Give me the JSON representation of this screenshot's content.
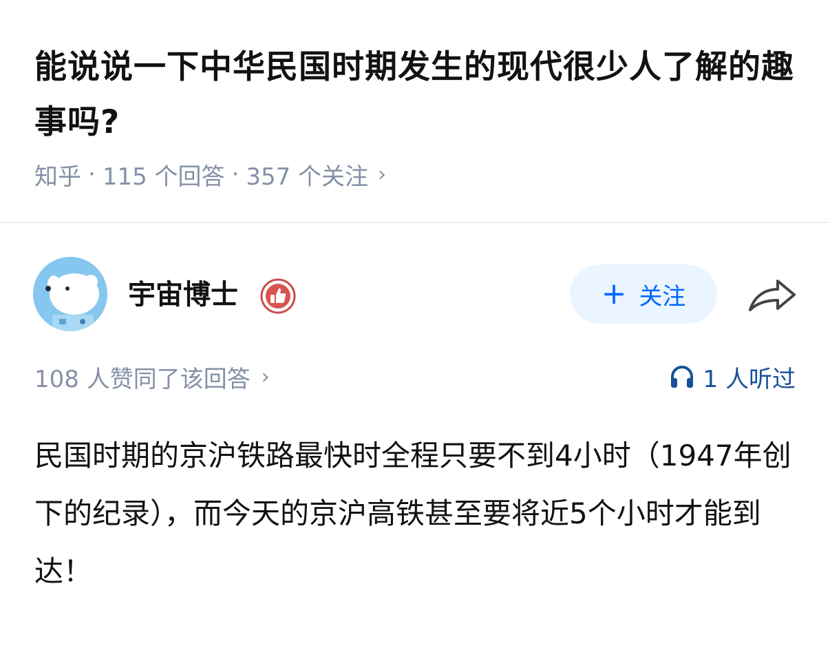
{
  "question": {
    "title": "能说说一下中华民国时期发生的现代很少人了解的趣事吗?",
    "site": "知乎",
    "separator": "·",
    "answers": "115 个回答",
    "followers": "357 个关注",
    "chevron": "›"
  },
  "author": {
    "name": "宇宙博士",
    "avatar_icon": "astronaut-dog-avatar",
    "badge_icon": "thumbs-up-badge-icon",
    "follow_label": "关注",
    "follow_plus": "+",
    "share_icon": "share-arrow-icon"
  },
  "stats": {
    "votes": "108 人赞同了该回答",
    "votes_chevron": "›",
    "listens": "1 人听过",
    "listen_icon": "headphones-icon"
  },
  "answer": {
    "text": "民国时期的京沪铁路最快时全程只要不到4小时（1947年创下的纪录），而今天的京沪高铁甚至要将近5个小时才能到达！"
  },
  "colors": {
    "brand_blue": "#0066ff",
    "follow_bg": "#ebf5ff",
    "meta_gray": "#8590a6",
    "listen_blue": "#175199",
    "badge_red": "#d9534f"
  }
}
